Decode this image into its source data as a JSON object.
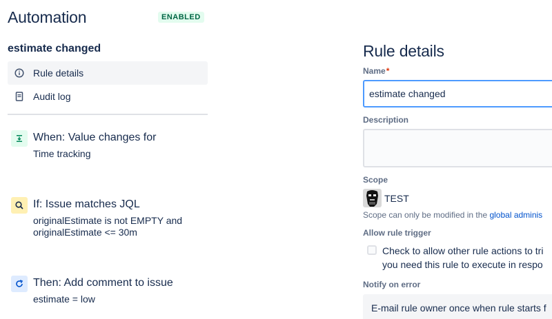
{
  "app": {
    "title": "Automation",
    "status_badge": "ENABLED"
  },
  "rule": {
    "name": "estimate changed"
  },
  "nav": {
    "items": [
      {
        "label": "Rule details",
        "icon": "info-icon",
        "active": true
      },
      {
        "label": "Audit log",
        "icon": "document-icon",
        "active": false
      }
    ]
  },
  "components": [
    {
      "type": "trigger",
      "icon": "value-change-icon",
      "title": "When: Value changes for",
      "lines": [
        "Time tracking"
      ]
    },
    {
      "type": "condition",
      "icon": "search-icon",
      "title": "If: Issue matches JQL",
      "lines": [
        "originalEstimate is not EMPTY and",
        "originalEstimate <= 30m"
      ]
    },
    {
      "type": "action",
      "icon": "refresh-icon",
      "title": "Then: Add comment to issue",
      "lines": [
        "estimate = low"
      ]
    }
  ],
  "details": {
    "title": "Rule details",
    "name_label": "Name",
    "required_mark": "*",
    "name_value": "estimate changed",
    "description_label": "Description",
    "description_value": "",
    "scope_label": "Scope",
    "scope_value": "TEST",
    "scope_note_prefix": "Scope can only be modified in the ",
    "scope_note_link": "global adminis",
    "allow_trigger_label": "Allow rule trigger",
    "allow_trigger_line1": "Check to allow other rule actions to tri",
    "allow_trigger_line2": "you need this rule to execute in respo",
    "notify_label": "Notify on error",
    "notify_value": "E-mail rule owner once when rule starts f"
  },
  "colors": {
    "trigger_bg": "#e3fcef",
    "trigger_fg": "#00875a",
    "condition_bg": "#fff0b3",
    "condition_fg": "#172b4d",
    "action_bg": "#deebff",
    "action_fg": "#0052cc",
    "focus_border": "#4c9aff",
    "link": "#0052cc"
  }
}
